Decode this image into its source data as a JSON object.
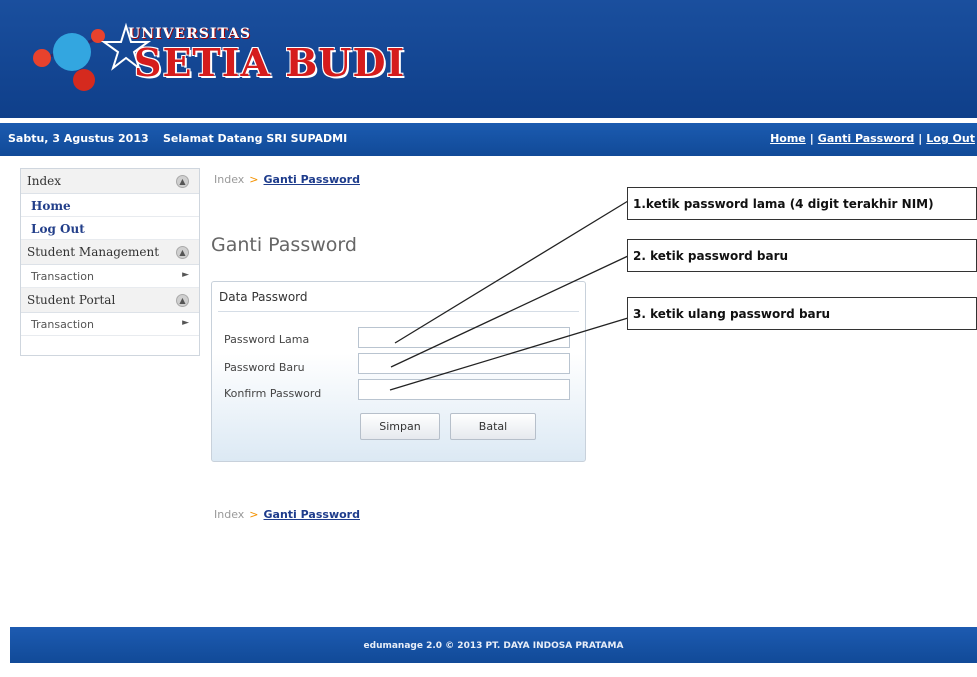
{
  "header": {
    "logo_top": "UNIVERSITAS",
    "logo_setia": "SETIA",
    "logo_budi": "BUDI"
  },
  "topbar": {
    "date": "Sabtu, 3 Agustus 2013",
    "welcome": "Selamat Datang SRI SUPADMI",
    "links": [
      "Home",
      "Ganti Password",
      "Log Out"
    ]
  },
  "sidebar": {
    "sections": [
      {
        "title": "Index",
        "items": [
          "Home",
          "Log Out"
        ]
      },
      {
        "title": "Student Management",
        "items": [
          "Transaction"
        ]
      },
      {
        "title": "Student Portal",
        "items": [
          "Transaction"
        ]
      }
    ]
  },
  "breadcrumb": {
    "root": "Index",
    "separator": ">",
    "current": "Ganti Password"
  },
  "page_title": "Ganti Password",
  "form": {
    "section_title": "Data Password",
    "fields": [
      {
        "label": "Password Lama",
        "value": ""
      },
      {
        "label": "Password Baru",
        "value": ""
      },
      {
        "label": "Konfirm Password",
        "value": ""
      }
    ],
    "save_label": "Simpan",
    "cancel_label": "Batal"
  },
  "annotations": [
    "1.ketik password lama (4 digit terakhir NIM)",
    "2. ketik password baru",
    "3. ketik ulang password baru"
  ],
  "footer": {
    "text": "edumanage 2.0 © 2013 PT. DAYA INDOSA PRATAMA"
  },
  "colors": {
    "header_blue": "#114a98",
    "link_blue": "#1e3c8c",
    "logo_red": "#d51c1c",
    "breadcrumb_sep": "#f39200"
  }
}
